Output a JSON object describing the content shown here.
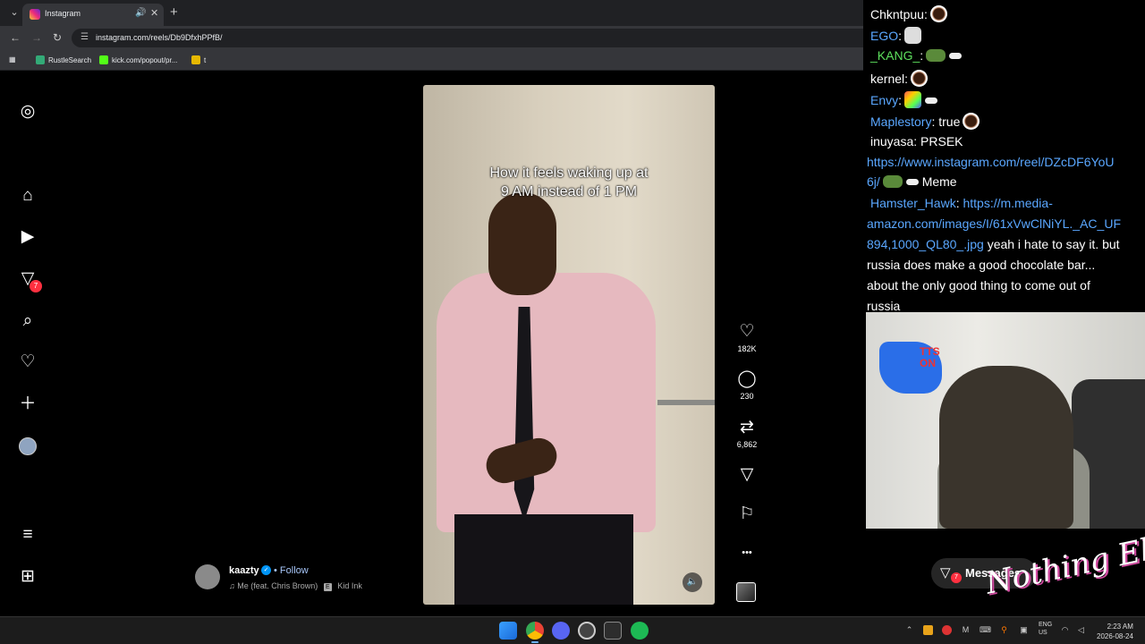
{
  "browser": {
    "tab_title": "Instagram",
    "url": "instagram.com/reels/Db9DfxhPPfB/",
    "bookmarks": [
      "RustleSearch",
      "kick.com/popout/pr...",
      "t"
    ],
    "icons": {
      "back": "←",
      "forward": "→",
      "reload": "↻",
      "new_tab": "+",
      "close": "✕",
      "minimize": "—",
      "maximize": "▢",
      "audio": "🔊"
    }
  },
  "instagram": {
    "caption_line1": "How it feels waking up at",
    "caption_line2": "9 AM instead of 1 PM",
    "likes": "182K",
    "comments": "230",
    "reposts": "6,862",
    "author": "kaazty",
    "follow_label": "Follow",
    "bullet": "•",
    "music_title": "Me (feat. Chris Brown)",
    "explicit": "E",
    "music_artist": "Kid Ink",
    "notification_count": "7",
    "icons": {
      "heart": "♡",
      "comment": "◯",
      "repost": "⇄",
      "share": "▽",
      "save": "⚐",
      "more": "•••",
      "music": "♫",
      "mute": "🔈"
    }
  },
  "chat": {
    "messages": [
      {
        "user": "Chkntpuu",
        "text": ""
      },
      {
        "user": "EGO",
        "text": ""
      },
      {
        "user": "_KANG_",
        "text": ""
      },
      {
        "user": "kernel",
        "text": ""
      },
      {
        "user": "Envy",
        "text": ""
      },
      {
        "user": "Maplestory",
        "text": "true"
      },
      {
        "user": "inuyasa",
        "text": "PRSEK"
      }
    ],
    "link1_line1": "https://www.instagram.com/reel/DZcDF6YoU",
    "link1_line2": "6j/",
    "link1_text": "Meme",
    "hamster_user": "Hamster_Hawk",
    "link2_line1": "https://m.media-",
    "link2_line2": "amazon.com/images/I/61xVwClNiYL._AC_UF",
    "link2_line3": "894,1000_QL80_.jpg",
    "hamster_text_1": "yeah i hate to say it. but",
    "hamster_text_2": "russia does make a good chocolate bar...",
    "hamster_text_3": "about the only good thing to come out of",
    "hamster_text_4": "russia"
  },
  "webcam": {
    "overlay_text_1": "TTS",
    "overlay_text_2": "ON"
  },
  "messages_button": {
    "label": "Messages",
    "badge": "7"
  },
  "stream_logo": "Nothing Else?",
  "taskbar": {
    "lang_1": "ENG",
    "lang_2": "US",
    "time": "2:23 AM",
    "date": "2026-08-24"
  }
}
